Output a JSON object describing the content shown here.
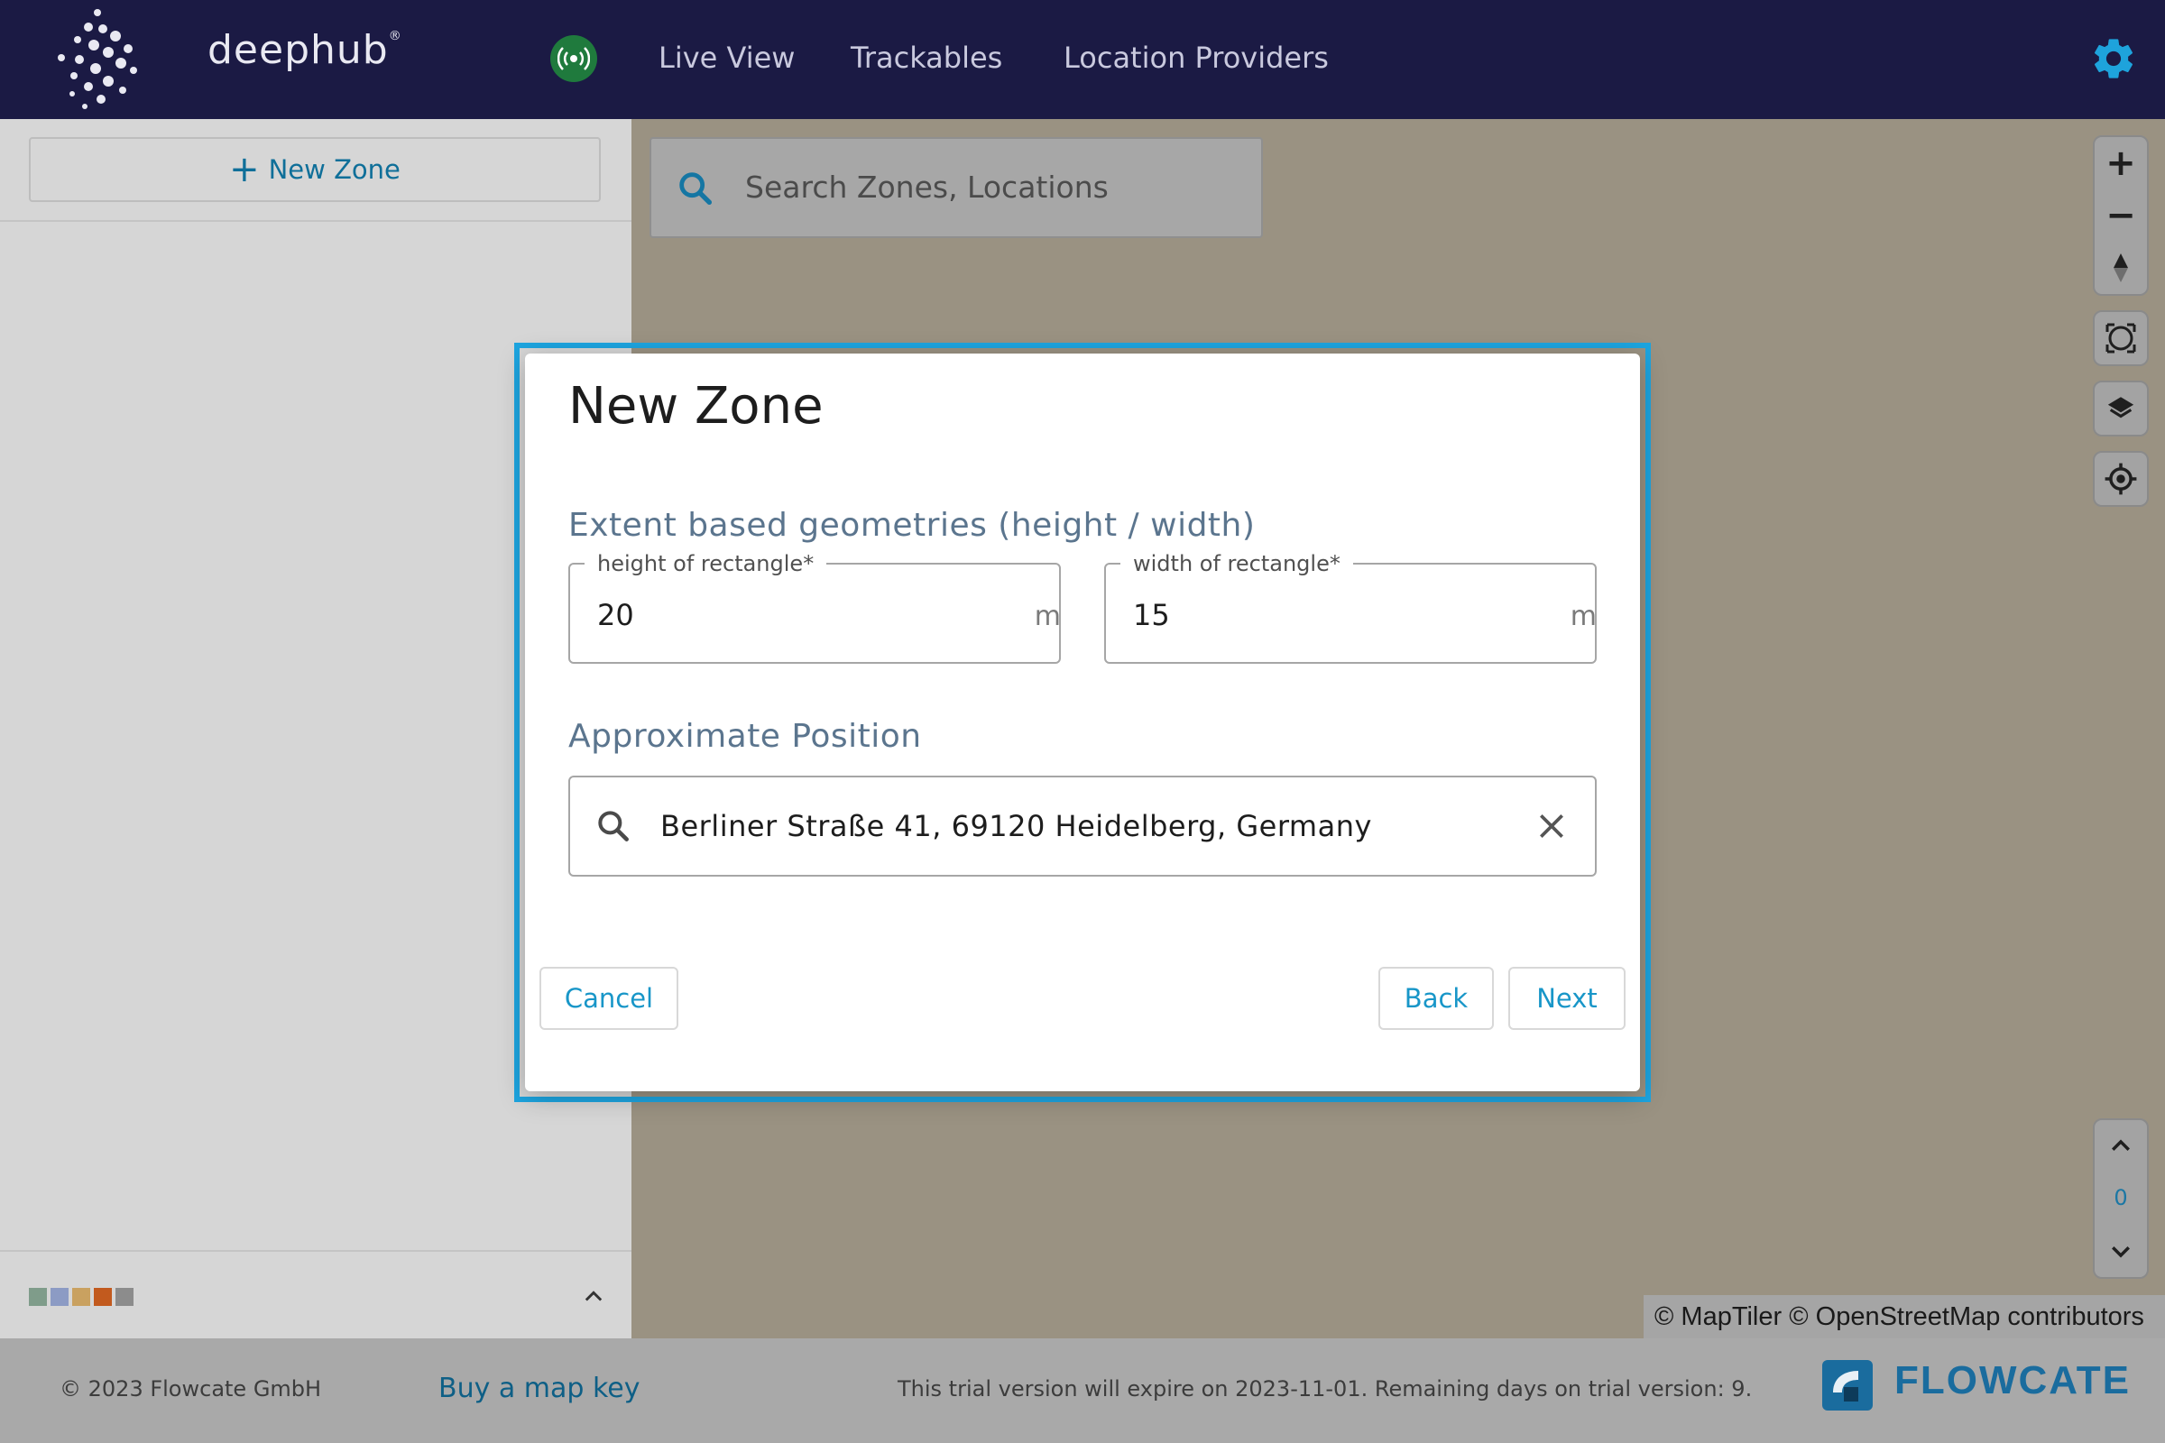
{
  "app": {
    "logo_text": "deephub",
    "logo_mark": "®"
  },
  "nav": {
    "items": [
      {
        "label": "Live View"
      },
      {
        "label": "Trackables"
      },
      {
        "label": "Location Providers"
      }
    ],
    "status_icon": "broadcast-icon",
    "settings_icon": "gear-icon"
  },
  "sidebar": {
    "new_zone_label": "New Zone",
    "swatch_colors": [
      "#7f9c8a",
      "#8c9bc4",
      "#c9a160",
      "#c25a1e",
      "#8c8c8c"
    ]
  },
  "map": {
    "search_placeholder": "Search Zones, Locations",
    "floor_level": "0",
    "attribution": "© MapTiler © OpenStreetMap contributors",
    "background_color": "#9a9282"
  },
  "dialog": {
    "title": "New Zone",
    "extent_label": "Extent based geometries (height / width)",
    "height_label": "height of rectangle*",
    "height_value": "20",
    "height_unit": "m",
    "width_label": "width of rectangle*",
    "width_value": "15",
    "width_unit": "m",
    "position_label": "Approximate Position",
    "position_value": "Berliner Straße 41, 69120 Heidelberg, Germany",
    "cancel_label": "Cancel",
    "back_label": "Back",
    "next_label": "Next",
    "accent_color": "#1da5e0"
  },
  "footer": {
    "copyright": "© 2023 Flowcate GmbH",
    "buy_key": "Buy a map key",
    "trial": "This trial version will expire on 2023-11-01. Remaining days on trial version: 9.",
    "brand": "FLOWCATE"
  }
}
